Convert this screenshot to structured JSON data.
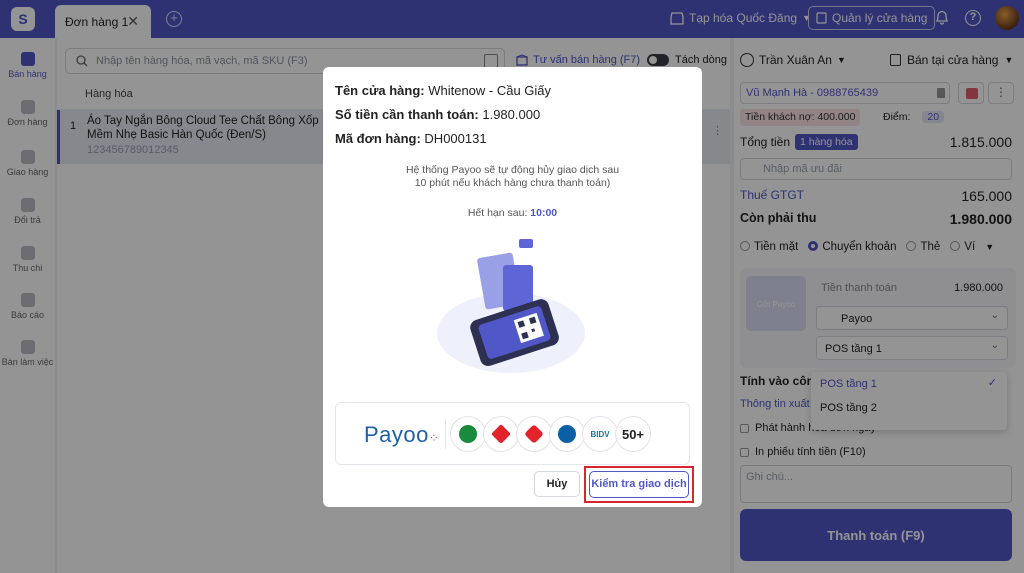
{
  "topbar": {
    "tab_label": "Đơn hàng 1",
    "tab_close": "✕",
    "add_tab": "+",
    "store_name": "Tạp hóa Quốc Đăng",
    "store_manage": "Quản lý cửa hàng",
    "help_glyph": "?",
    "accent": "#5057c7"
  },
  "sidebar": {
    "items": [
      {
        "label": "Bán hàng",
        "icon": "cart-icon"
      },
      {
        "label": "Đơn hàng",
        "icon": "document-icon"
      },
      {
        "label": "Giao hàng",
        "icon": "truck-icon"
      },
      {
        "label": "Đổi trả",
        "icon": "return-icon"
      },
      {
        "label": "Thu chi",
        "icon": "cash-icon"
      },
      {
        "label": "Báo cáo",
        "icon": "report-icon"
      },
      {
        "label": "Bàn làm việc",
        "icon": "flag-icon"
      }
    ]
  },
  "center": {
    "search_placeholder": "Nhập tên hàng hóa, mã vạch, mã SKU (F3)",
    "consult": "Tư vấn bán hàng (F7)",
    "split": "Tách dòng",
    "col_header": "Hàng hóa",
    "row": {
      "num": "1",
      "name": "Áo Tay Ngắn Bông Cloud Tee Chất Bông Xốp Mềm Nhẹ Basic Hàn Quốc (Đen/S)",
      "sku": "123456789012345"
    }
  },
  "right": {
    "user": "Trần Xuân An",
    "mode": "Bán tại cửa hàng",
    "customer": "Vũ Mạnh Hà - 0988765439",
    "debt_label": "Tiền khách nợ:",
    "debt_value": "400.000",
    "points_label": "Điểm:",
    "points_value": "20",
    "total_label": "Tổng tiền",
    "total_badge": "1 hàng hóa",
    "total_value": "1.815.000",
    "promo_placeholder": "Nhập mã ưu đãi",
    "tax_label": "Thuế GTGT",
    "tax_value": "165.000",
    "remain_label": "Còn phải thu",
    "remain_value": "1.980.000",
    "methods": [
      "Tiền mặt",
      "Chuyển khoản",
      "Thẻ",
      "Ví"
    ],
    "payoo_thumb": "Gửi Payoo",
    "pay_amount_label": "Tiền thanh toán",
    "pay_amount_value": "1.980.000",
    "gateway": "Payoo",
    "pos_selected": "POS tầng 1",
    "pos_options": [
      "POS tầng 1",
      "POS tầng 2"
    ],
    "include_label": "Tính vào côn",
    "info_link": "Thông tin xuất",
    "issue_invoice": "Phát hành hóa đơn ngay",
    "print_bill": "In phiếu tính tiền (F10)",
    "note_placeholder": "Ghi chú...",
    "pay_button": "Thanh toán (F9)"
  },
  "modal": {
    "store_label": "Tên cửa hàng:",
    "store_value": "Whitenow - Cầu Giấy",
    "amount_label": "Số tiền cần thanh toán:",
    "amount_value": "1.980.000",
    "order_label": "Mã đơn hàng:",
    "order_value": "DH000131",
    "note_line1": "Hệ thống Payoo sẽ tự động hủy giao dịch sau",
    "note_line2": "10 phút nếu khách hàng chưa thanh toán)",
    "expire_label": "Hết hạn sau:",
    "expire_value": "10:00",
    "payoo_logo": "Payoo",
    "bdv_text": "BIDV",
    "more_banks": "50+",
    "cancel_button": "Hủy",
    "check_button": "Kiểm tra giao dịch",
    "highlight_color": "#d8262f"
  }
}
